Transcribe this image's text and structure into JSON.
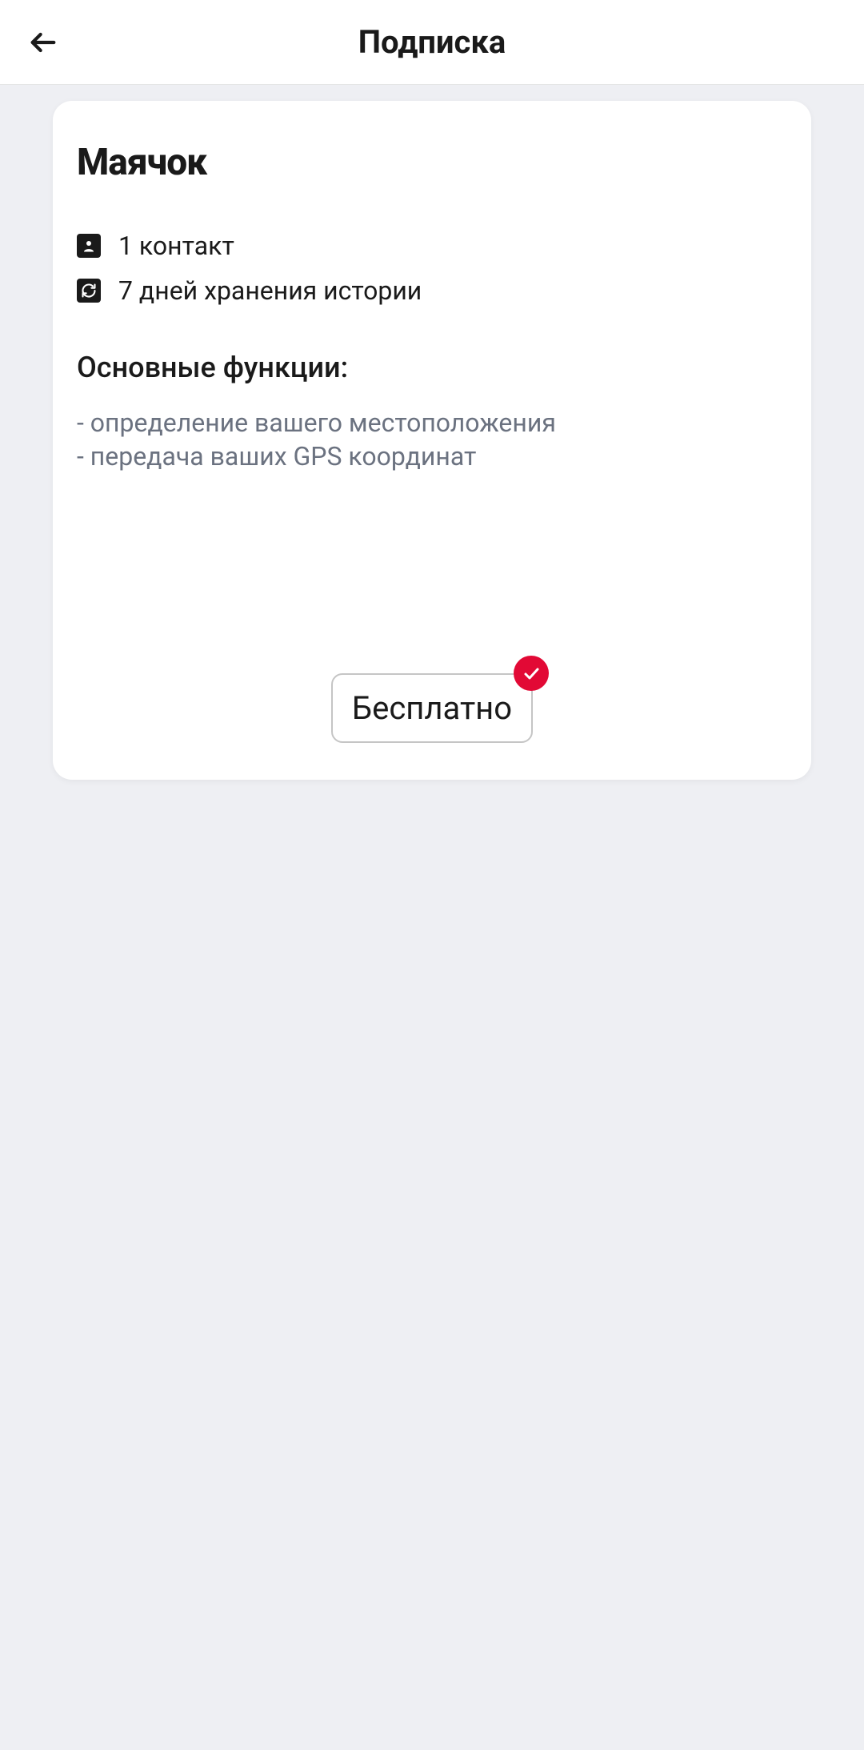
{
  "header": {
    "title": "Подписка"
  },
  "card": {
    "title": "Маячок",
    "features": [
      {
        "icon": "person",
        "label": "1 контакт"
      },
      {
        "icon": "history",
        "label": "7 дней хранения истории"
      }
    ],
    "section_title": "Основные функции:",
    "bullets": [
      "- определение вашего местоположения",
      "- передача ваших GPS координат"
    ],
    "price": {
      "label": "Бесплатно",
      "selected": true
    }
  },
  "colors": {
    "accent": "#e20935",
    "background": "#eeeff3",
    "text_primary": "#1a1a1a",
    "text_secondary": "#6b7280"
  }
}
